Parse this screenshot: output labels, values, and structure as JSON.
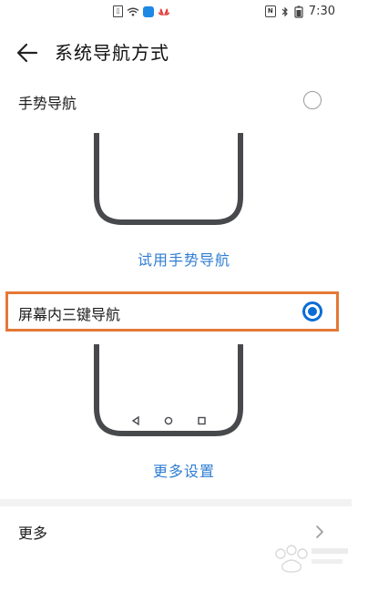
{
  "status": {
    "time": "7:30",
    "left_icons": [
      "sim-icon",
      "wifi-icon",
      "cloud-icon",
      "huawei-icon"
    ],
    "right_icons": [
      "nfc-icon",
      "bluetooth-icon",
      "battery-icon"
    ]
  },
  "appbar": {
    "title": "系统导航方式"
  },
  "options": [
    {
      "label": "手势导航",
      "selected": false,
      "link": "试用手势导航"
    },
    {
      "label": "屏幕内三键导航",
      "selected": true,
      "link": "更多设置"
    }
  ],
  "more": {
    "label": "更多"
  },
  "colors": {
    "accent": "#0a6cd6",
    "link": "#2f7dd3",
    "highlight": "#e57835"
  }
}
